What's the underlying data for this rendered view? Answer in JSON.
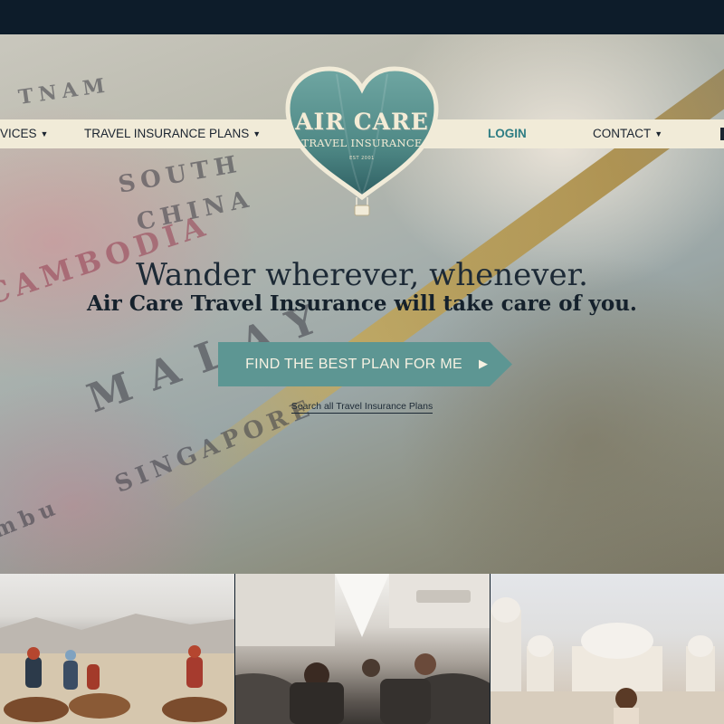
{
  "nav": {
    "items": [
      {
        "label": "VICES",
        "caret": "▼"
      },
      {
        "label": "TRAVEL INSURANCE PLANS",
        "caret": "▼"
      },
      {
        "label": "LOGIN",
        "caret": ""
      },
      {
        "label": "CONTACT",
        "caret": "▼"
      }
    ]
  },
  "logo": {
    "title": "AIR CARE",
    "subtitle": "TRAVEL INSURANCE",
    "est": "EST 2001",
    "colors": {
      "heart": "#5d9693",
      "border": "#f1ebd8"
    }
  },
  "hero": {
    "headline": "Wander wherever, whenever.",
    "subheadline": "Air Care Travel Insurance will take care of you.",
    "cta_label": "FIND THE BEST PLAN FOR ME",
    "cta_icon": "play-arrow-icon",
    "search_link": "Search all Travel Insurance Plans",
    "map_words": [
      "TNAM",
      "SOUTH",
      "CHINA",
      "CAMBODIA",
      "MALAY",
      "SINGAPORE",
      "mbu"
    ]
  },
  "colors": {
    "top_bar": "#0d1c2a",
    "nav_strip": "#f1ebd8",
    "accent": "#5d9693",
    "login": "#2e7d83",
    "text_dark": "#1d2a36"
  },
  "photos": [
    {
      "name": "camel-caravan-desert"
    },
    {
      "name": "airplane-cabin"
    },
    {
      "name": "white-palace"
    }
  ]
}
